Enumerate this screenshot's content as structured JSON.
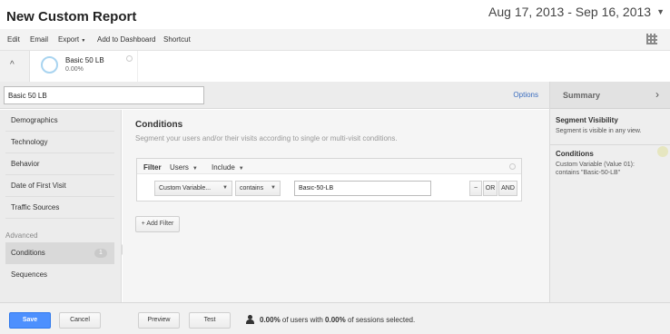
{
  "header": {
    "title": "New Custom Report",
    "date_range": "Aug 17, 2013 - Sep 16, 2013"
  },
  "toolbar": {
    "edit": "Edit",
    "email": "Email",
    "export": "Export",
    "add_to_dashboard": "Add to Dashboard",
    "shortcut": "Shortcut"
  },
  "segment_chip": {
    "name": "Basic 50 LB",
    "percent": "0.00%"
  },
  "editor": {
    "segment_name_value": "Basic 50 LB",
    "options_label": "Options",
    "nav": {
      "items": [
        "Demographics",
        "Technology",
        "Behavior",
        "Date of First Visit",
        "Traffic Sources"
      ],
      "advanced_header": "Advanced",
      "advanced_items": [
        "Conditions",
        "Sequences"
      ],
      "conditions_badge": "1"
    },
    "conditions": {
      "title": "Conditions",
      "description": "Segment your users and/or their visits according to single or multi-visit conditions.",
      "filter_label": "Filter",
      "filter_scope": "Users",
      "filter_mode": "Include",
      "dimension": "Custom Variable...",
      "operator": "contains",
      "value": "Basic-50-LB",
      "minus": "−",
      "or": "OR",
      "and": "AND",
      "add_filter": "+ Add Filter"
    },
    "summary": {
      "title": "Summary",
      "visibility_title": "Segment Visibility",
      "visibility_text": "Segment is visible in any view.",
      "conditions_title": "Conditions",
      "conditions_line1": "Custom Variable (Value 01):",
      "conditions_line2": "contains \"Basic-50-LB\""
    }
  },
  "footer": {
    "save": "Save",
    "cancel": "Cancel",
    "preview": "Preview",
    "test": "Test",
    "users_pct": "0.00%",
    "users_mid": " of users with ",
    "sessions_pct": "0.00%",
    "sessions_end": " of sessions selected."
  },
  "colors": {
    "save_blue": "#4d90fe",
    "link_blue": "#3b6dbf"
  }
}
